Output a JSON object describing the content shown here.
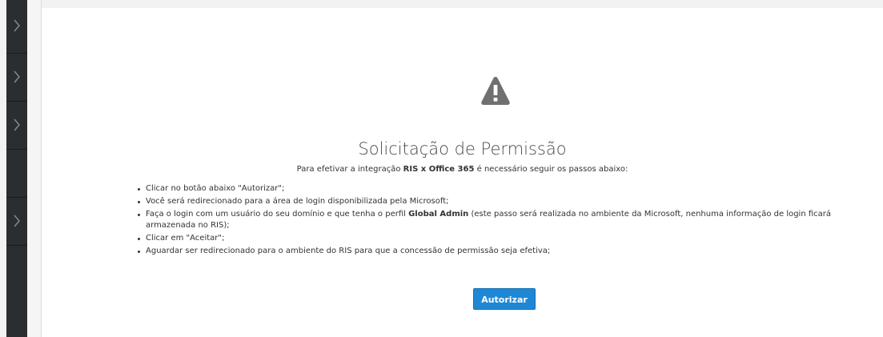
{
  "sidebar": {
    "items": [
      {
        "icon": "chevron-right-icon"
      },
      {
        "icon": "chevron-right-icon"
      },
      {
        "icon": "chevron-right-icon"
      },
      {
        "icon": null
      },
      {
        "icon": "chevron-right-icon"
      }
    ]
  },
  "main": {
    "icon": "warning-icon",
    "title": "Solicitação de Permissão",
    "subtitle_prefix": "Para efetivar a integração ",
    "subtitle_bold": "RIS x Office 365",
    "subtitle_suffix": " é necessário seguir os passos abaixo:",
    "steps": {
      "s0": "Clicar no botão abaixo \"Autorizar\";",
      "s1": "Você será redirecionado para a área de login disponibilizada pela Microsoft;",
      "s2_prefix": "Faça o login com um usuário do seu domínio e que tenha o perfil ",
      "s2_bold": "Global Admin",
      "s2_suffix": " (este passo será realizada no ambiente da Microsoft, nenhuma informação de login ficará armazenada no RIS);",
      "s3": "Clicar em \"Aceitar\";",
      "s4": "Aguardar ser redirecionado para o ambiente do RIS para que a concessão de permissão seja efetiva;"
    },
    "authorize_button": "Autorizar"
  },
  "colors": {
    "sidebar_bg": "#2b2e31",
    "button_bg": "#1e88d6",
    "icon_gray": "#707070"
  }
}
